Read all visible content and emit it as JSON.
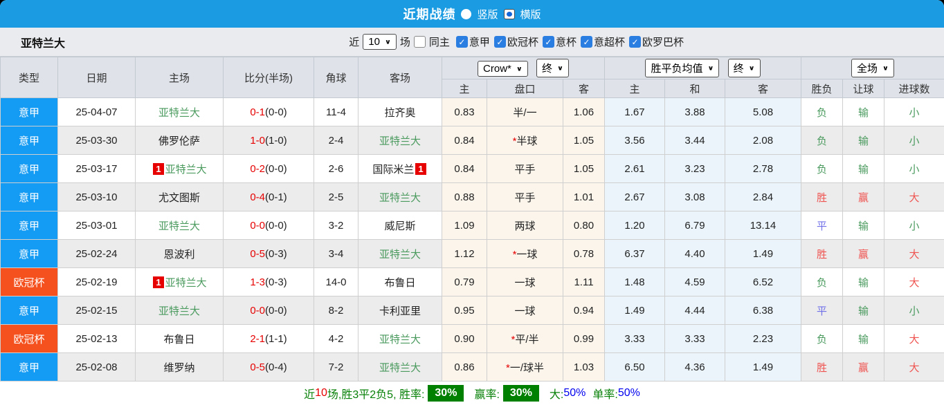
{
  "titlebar": {
    "title": "近期战绩",
    "radio_vertical": "竖版",
    "radio_horizontal": "横版"
  },
  "filter": {
    "team": "亚特兰大",
    "near_label": "近",
    "match_count": "10",
    "games_label": "场",
    "same_home_label": "同主",
    "leagues": [
      "意甲",
      "欧冠杯",
      "意杯",
      "意超杯",
      "欧罗巴杯"
    ]
  },
  "table": {
    "left_cols": [
      "类型",
      "日期",
      "主场",
      "比分(半场)",
      "角球",
      "客场"
    ],
    "group1": {
      "select1": "Crow*",
      "select2": "终"
    },
    "group2": {
      "select1": "胜平负均值",
      "select2": "终"
    },
    "group3": {
      "select": "全场"
    },
    "sub_cols": [
      "主",
      "盘口",
      "客",
      "主",
      "和",
      "客",
      "胜负",
      "让球",
      "进球数"
    ],
    "rows": [
      {
        "type": "意甲",
        "tc": "blue",
        "date": "25-04-07",
        "home": "亚特兰大",
        "home_self": true,
        "home_red": "",
        "score": "0-1",
        "half": "(0-0)",
        "corners": "11-4",
        "away": "拉齐奥",
        "away_self": false,
        "away_red": "",
        "o_home": "0.83",
        "h_star": false,
        "handicap": "半/一",
        "o_away": "1.06",
        "avg": [
          "1.67",
          "3.88",
          "5.08"
        ],
        "res": [
          [
            "负",
            "g"
          ],
          [
            "输",
            "g"
          ],
          [
            "小",
            "g"
          ]
        ]
      },
      {
        "type": "意甲",
        "tc": "blue",
        "date": "25-03-30",
        "home": "佛罗伦萨",
        "home_self": false,
        "home_red": "",
        "score": "1-0",
        "half": "(1-0)",
        "corners": "2-4",
        "away": "亚特兰大",
        "away_self": true,
        "away_red": "",
        "o_home": "0.84",
        "h_star": true,
        "handicap": "半球",
        "o_away": "1.05",
        "avg": [
          "3.56",
          "3.44",
          "2.08"
        ],
        "res": [
          [
            "负",
            "g"
          ],
          [
            "输",
            "g"
          ],
          [
            "小",
            "g"
          ]
        ]
      },
      {
        "type": "意甲",
        "tc": "blue",
        "date": "25-03-17",
        "home": "亚特兰大",
        "home_self": true,
        "home_red": "1",
        "score": "0-2",
        "half": "(0-0)",
        "corners": "2-6",
        "away": "国际米兰",
        "away_self": false,
        "away_red": "1",
        "o_home": "0.84",
        "h_star": false,
        "handicap": "平手",
        "o_away": "1.05",
        "avg": [
          "2.61",
          "3.23",
          "2.78"
        ],
        "res": [
          [
            "负",
            "g"
          ],
          [
            "输",
            "g"
          ],
          [
            "小",
            "g"
          ]
        ]
      },
      {
        "type": "意甲",
        "tc": "blue",
        "date": "25-03-10",
        "home": "尤文图斯",
        "home_self": false,
        "home_red": "",
        "score": "0-4",
        "half": "(0-1)",
        "corners": "2-5",
        "away": "亚特兰大",
        "away_self": true,
        "away_red": "",
        "o_home": "0.88",
        "h_star": false,
        "handicap": "平手",
        "o_away": "1.01",
        "avg": [
          "2.67",
          "3.08",
          "2.84"
        ],
        "res": [
          [
            "胜",
            "r"
          ],
          [
            "赢",
            "r"
          ],
          [
            "大",
            "r"
          ]
        ]
      },
      {
        "type": "意甲",
        "tc": "blue",
        "date": "25-03-01",
        "home": "亚特兰大",
        "home_self": true,
        "home_red": "",
        "score": "0-0",
        "half": "(0-0)",
        "corners": "3-2",
        "away": "威尼斯",
        "away_self": false,
        "away_red": "",
        "o_home": "1.09",
        "h_star": false,
        "handicap": "两球",
        "o_away": "0.80",
        "avg": [
          "1.20",
          "6.79",
          "13.14"
        ],
        "res": [
          [
            "平",
            "b"
          ],
          [
            "输",
            "g"
          ],
          [
            "小",
            "g"
          ]
        ]
      },
      {
        "type": "意甲",
        "tc": "blue",
        "date": "25-02-24",
        "home": "恩波利",
        "home_self": false,
        "home_red": "",
        "score": "0-5",
        "half": "(0-3)",
        "corners": "3-4",
        "away": "亚特兰大",
        "away_self": true,
        "away_red": "",
        "o_home": "1.12",
        "h_star": true,
        "handicap": "一球",
        "o_away": "0.78",
        "avg": [
          "6.37",
          "4.40",
          "1.49"
        ],
        "res": [
          [
            "胜",
            "r"
          ],
          [
            "赢",
            "r"
          ],
          [
            "大",
            "r"
          ]
        ]
      },
      {
        "type": "欧冠杯",
        "tc": "orange",
        "date": "25-02-19",
        "home": "亚特兰大",
        "home_self": true,
        "home_red": "1",
        "score": "1-3",
        "half": "(0-3)",
        "corners": "14-0",
        "away": "布鲁日",
        "away_self": false,
        "away_red": "",
        "o_home": "0.79",
        "h_star": false,
        "handicap": "一球",
        "o_away": "1.11",
        "avg": [
          "1.48",
          "4.59",
          "6.52"
        ],
        "res": [
          [
            "负",
            "g"
          ],
          [
            "输",
            "g"
          ],
          [
            "大",
            "r"
          ]
        ]
      },
      {
        "type": "意甲",
        "tc": "blue",
        "date": "25-02-15",
        "home": "亚特兰大",
        "home_self": true,
        "home_red": "",
        "score": "0-0",
        "half": "(0-0)",
        "corners": "8-2",
        "away": "卡利亚里",
        "away_self": false,
        "away_red": "",
        "o_home": "0.95",
        "h_star": false,
        "handicap": "一球",
        "o_away": "0.94",
        "avg": [
          "1.49",
          "4.44",
          "6.38"
        ],
        "res": [
          [
            "平",
            "b"
          ],
          [
            "输",
            "g"
          ],
          [
            "小",
            "g"
          ]
        ]
      },
      {
        "type": "欧冠杯",
        "tc": "orange",
        "date": "25-02-13",
        "home": "布鲁日",
        "home_self": false,
        "home_red": "",
        "score": "2-1",
        "half": "(1-1)",
        "corners": "4-2",
        "away": "亚特兰大",
        "away_self": true,
        "away_red": "",
        "o_home": "0.90",
        "h_star": true,
        "handicap": "平/半",
        "o_away": "0.99",
        "avg": [
          "3.33",
          "3.33",
          "2.23"
        ],
        "res": [
          [
            "负",
            "g"
          ],
          [
            "输",
            "g"
          ],
          [
            "大",
            "r"
          ]
        ]
      },
      {
        "type": "意甲",
        "tc": "blue",
        "date": "25-02-08",
        "home": "维罗纳",
        "home_self": false,
        "home_red": "",
        "score": "0-5",
        "half": "(0-4)",
        "corners": "7-2",
        "away": "亚特兰大",
        "away_self": true,
        "away_red": "",
        "o_home": "0.86",
        "h_star": true,
        "handicap": "一/球半",
        "o_away": "1.03",
        "avg": [
          "6.50",
          "4.36",
          "1.49"
        ],
        "res": [
          [
            "胜",
            "r"
          ],
          [
            "赢",
            "r"
          ],
          [
            "大",
            "r"
          ]
        ]
      }
    ]
  },
  "summary": {
    "near_label": "近",
    "count": "10",
    "record_text": "场,胜3平2负5, 胜率:",
    "win_rate": "30%",
    "profit_label": "赢率:",
    "profit_rate": "30%",
    "big_label": "大:",
    "big_value": "50%",
    "single_label": "单率:",
    "single_value": "50%"
  },
  "colors": {
    "topbar_blue": "#1b9ce2",
    "league_blue": "#149bf3",
    "league_orange": "#f4511e",
    "self_team_green": "#4a9a5e",
    "loss_green": "#4a9a5e",
    "win_red": "#ef5350",
    "draw_blue": "#7070e8",
    "score_red": "#e60000",
    "rate_badge_green": "#008000",
    "summary_blue": "#0000ee"
  }
}
